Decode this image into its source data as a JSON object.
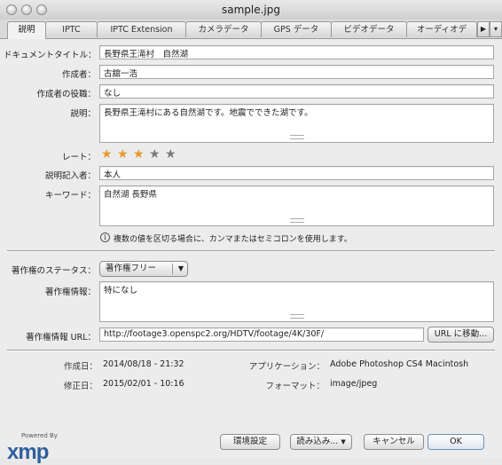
{
  "window": {
    "title": "sample.jpg"
  },
  "tabs": [
    {
      "label": "説明",
      "active": true
    },
    {
      "label": "IPTC"
    },
    {
      "label": "IPTC Extension"
    },
    {
      "label": "カメラデータ"
    },
    {
      "label": "GPS データ"
    },
    {
      "label": "ビデオデータ"
    },
    {
      "label": "オーディオデ"
    }
  ],
  "tab_scroll_icon": "right-triangle-icon",
  "description": {
    "document_title": {
      "label": "ドキュメントタイトル：",
      "value": "長野県王滝村　自然湖"
    },
    "author": {
      "label": "作成者：",
      "value": "古舘一浩"
    },
    "author_title": {
      "label": "作成者の役職：",
      "value": "なし"
    },
    "description_text": {
      "label": "説明：",
      "value": "長野県王滝村にある自然湖です。地震でできた湖です。"
    },
    "rating": {
      "label": "レート：",
      "value": 3,
      "max": 5,
      "filled_color": "#e8962e",
      "empty_color": "#7a7a7a"
    },
    "description_writer": {
      "label": "説明記入者：",
      "value": "本人"
    },
    "keywords": {
      "label": "キーワード：",
      "value": "自然湖 長野県"
    },
    "keywords_hint": "複数の値を区切る場合に、カンマまたはセミコロンを使用します。"
  },
  "copyright": {
    "status": {
      "label": "著作権のステータス：",
      "value": "著作権フリー"
    },
    "notice": {
      "label": "著作権情報：",
      "value": "特になし"
    },
    "info_url": {
      "label": "著作権情報 URL：",
      "value": "http://footage3.openspc2.org/HDTV/footage/4K/30F/",
      "go_button": "URL に移動..."
    }
  },
  "metadata": {
    "created": {
      "label": "作成日：",
      "value": "2014/08/18 - 21:32"
    },
    "modified": {
      "label": "修正日：",
      "value": "2015/02/01 - 10:16"
    },
    "application": {
      "label": "アプリケーション：",
      "value": "Adobe Photoshop CS4 Macintosh"
    },
    "format": {
      "label": "フォーマット：",
      "value": "image/jpeg"
    }
  },
  "footer": {
    "powered_by": "Powered By",
    "logo": "xmp",
    "preferences_button": "環境設定",
    "import_button": "読み込み...",
    "cancel_button": "キャンセル",
    "ok_button": "OK"
  }
}
